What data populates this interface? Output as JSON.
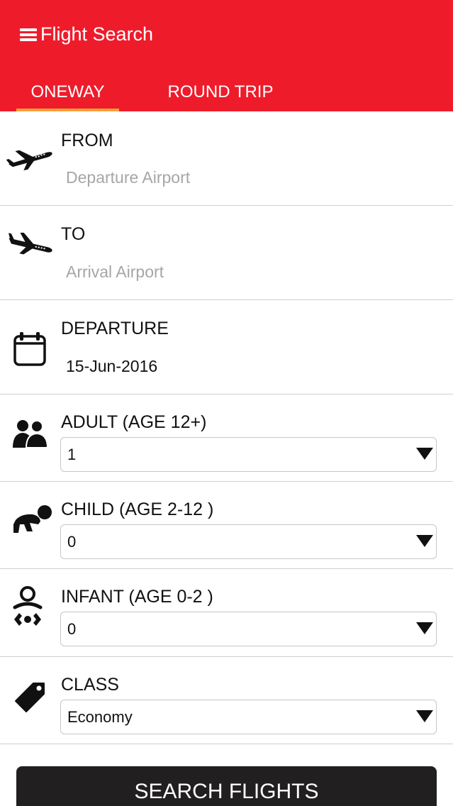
{
  "header": {
    "title": "Flight Search",
    "background_color": "#ee1c2b",
    "menu_icon": "hamburger-menu-icon"
  },
  "tabs": [
    {
      "label": "ONEWAY",
      "active": true
    },
    {
      "label": "ROUND TRIP",
      "active": false
    }
  ],
  "tab_indicator_color": "#f5a13a",
  "form": {
    "from": {
      "label": "FROM",
      "placeholder": "Departure Airport",
      "icon": "airplane-takeoff-icon"
    },
    "to": {
      "label": "TO",
      "placeholder": "Arrival Airport",
      "icon": "airplane-landing-icon"
    },
    "departure": {
      "label": "DEPARTURE",
      "value": "15-Jun-2016",
      "icon": "calendar-icon"
    },
    "adult": {
      "label": "ADULT (AGE 12+)",
      "value": "1",
      "icon": "people-icon"
    },
    "child": {
      "label": "CHILD (AGE 2-12 )",
      "value": "0",
      "icon": "crawling-baby-icon"
    },
    "infant": {
      "label": "INFANT (AGE 0-2 )",
      "value": "0",
      "icon": "infant-icon"
    },
    "class": {
      "label": "CLASS",
      "value": "Economy",
      "icon": "price-tag-icon"
    }
  },
  "search_button": {
    "label": "SEARCH FLIGHTS",
    "color": "#221f20"
  }
}
